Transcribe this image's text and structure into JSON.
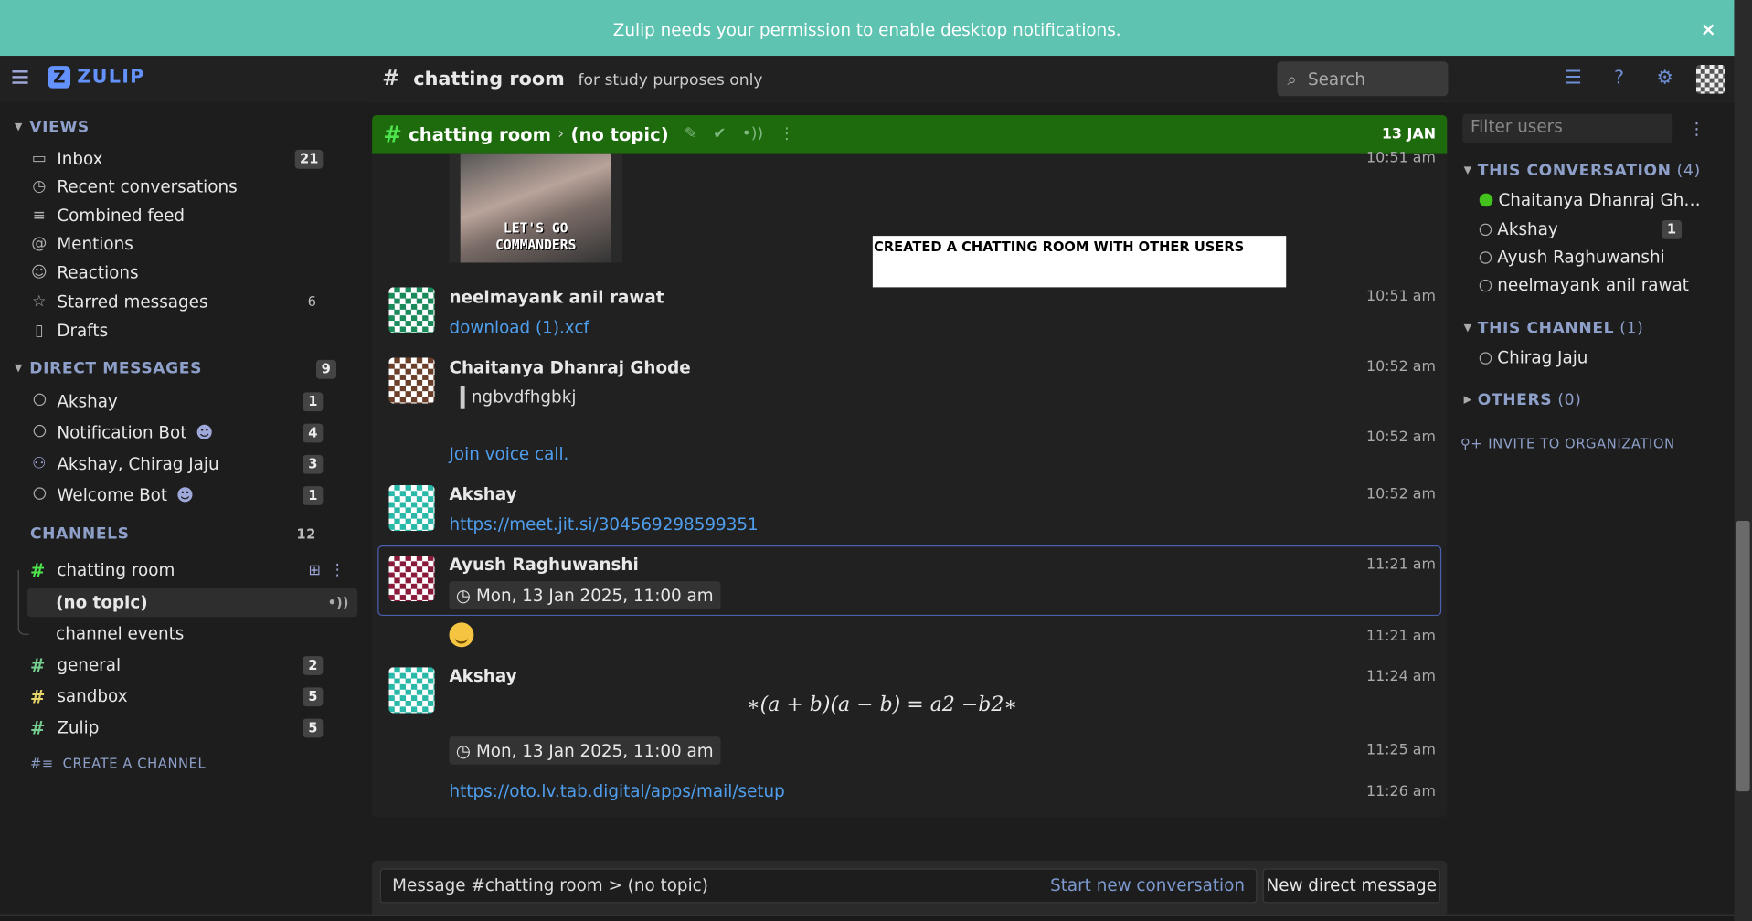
{
  "banner": {
    "text": "Zulip needs your permission to enable desktop notifications.",
    "close": "×"
  },
  "navbar": {
    "logo": "ZULIP",
    "channel": "chatting room",
    "description": "for study purposes only",
    "search_placeholder": "Search"
  },
  "left": {
    "views_title": "VIEWS",
    "views": [
      {
        "label": "Inbox",
        "icon": "inbox-icon",
        "count": "21",
        "badge": true
      },
      {
        "label": "Recent conversations",
        "icon": "clock-icon"
      },
      {
        "label": "Combined feed",
        "icon": "feed-icon"
      },
      {
        "label": "Mentions",
        "icon": "at-icon"
      },
      {
        "label": "Reactions",
        "icon": "smile-icon"
      },
      {
        "label": "Starred messages",
        "icon": "star-icon",
        "count": "6"
      },
      {
        "label": "Drafts",
        "icon": "draft-icon"
      }
    ],
    "dm_title": "DIRECT MESSAGES",
    "dm_count": "9",
    "dms": [
      {
        "label": "Akshay",
        "count": "1"
      },
      {
        "label": "Notification Bot",
        "count": "4"
      },
      {
        "label": "Akshay, Chirag Jaju",
        "count": "3"
      },
      {
        "label": "Welcome Bot",
        "count": "1"
      }
    ],
    "channels_title": "CHANNELS",
    "channels_count": "12",
    "channels": [
      {
        "label": "chatting room",
        "color": "#4ee44e"
      },
      {
        "label": "general",
        "color": "#76ce90",
        "count": "2"
      },
      {
        "label": "sandbox",
        "color": "#e4d46a",
        "count": "5"
      },
      {
        "label": "Zulip",
        "color": "#76ce90",
        "count": "5"
      }
    ],
    "topics": [
      "(no topic)",
      "channel events"
    ],
    "create_channel": "CREATE A CHANNEL"
  },
  "main": {
    "recipient": {
      "channel": "chatting room",
      "topic": "(no topic)",
      "date": "13 JAN"
    },
    "image_caption_1": "LET'S GO",
    "image_caption_2": "COMMANDERS",
    "image_time": "10:51 am",
    "white_box": "CREATED A CHATTING ROOM WITH OTHER USERS",
    "messages": [
      {
        "sender": "neelmayank anil rawat",
        "content": "download (1).xcf",
        "time": "10:51 am"
      },
      {
        "sender": "Chaitanya Dhanraj Ghode",
        "content": "ngbvdfhgbkj",
        "time": "10:52 am"
      },
      {
        "content": "Join voice call.",
        "time": "10:52 am"
      },
      {
        "sender": "Akshay",
        "content": "https://meet.jit.si/304569298599351",
        "time": "10:52 am"
      },
      {
        "sender": "Ayush Raghuwanshi",
        "content": "Mon, 13 Jan 2025, 11:00 am",
        "time": "11:21 am"
      },
      {
        "content": "emoji",
        "time": "11:21 am"
      },
      {
        "sender": "Akshay",
        "content": "∗(a + b)(a − b) = a2 −b2∗",
        "time": "11:24 am"
      },
      {
        "content": "Mon, 13 Jan 2025, 11:00 am",
        "time": "11:25 am"
      },
      {
        "content": "https://oto.lv.tab.digital/apps/mail/setup",
        "time": "11:26 am"
      }
    ]
  },
  "compose": {
    "placeholder": "Message #chatting room > (no topic)",
    "start_new": "Start new conversation",
    "new_dm": "New direct message"
  },
  "right": {
    "filter_placeholder": "Filter users",
    "this_conversation": "THIS CONVERSATION",
    "this_conversation_count": "(4)",
    "conversation_users": [
      {
        "name": "Chaitanya Dhanraj Gh…",
        "online": true
      },
      {
        "name": "Akshay",
        "count": "1"
      },
      {
        "name": "Ayush Raghuwanshi"
      },
      {
        "name": "neelmayank anil rawat"
      }
    ],
    "this_channel": "THIS CHANNEL",
    "this_channel_count": "(1)",
    "channel_users": [
      {
        "name": "Chirag Jaju"
      }
    ],
    "others": "OTHERS",
    "others_count": "(0)",
    "invite": "INVITE TO ORGANIZATION"
  }
}
